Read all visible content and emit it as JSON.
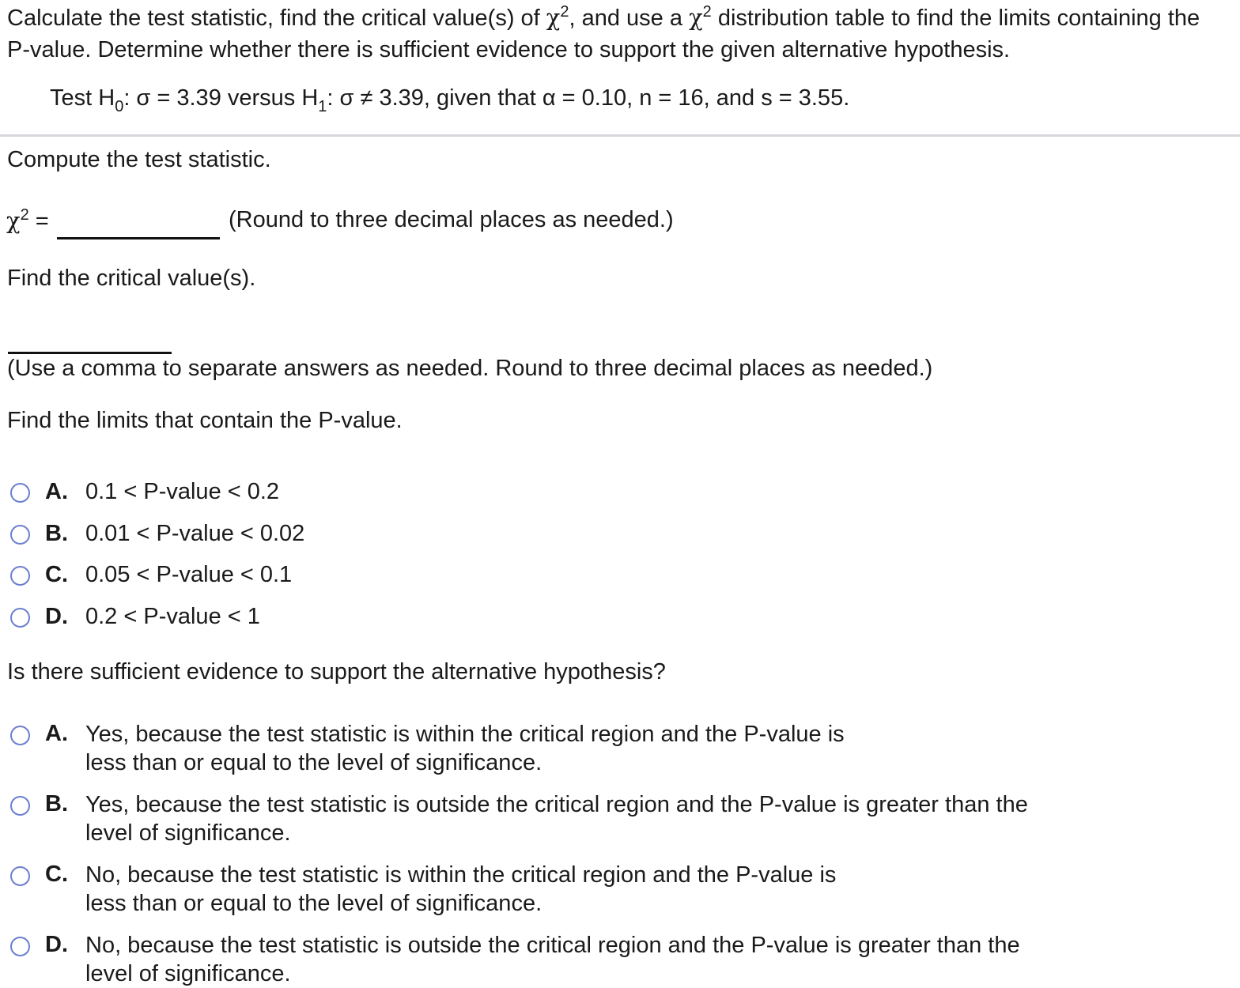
{
  "question": {
    "intro_part1": "Calculate the test statistic, find the critical value(s) of ",
    "chi_symbol": "χ",
    "sup2": "2",
    "intro_part2": ", and use a ",
    "intro_part3": " distribution table to find the limits containing the",
    "intro_line2": "P-value. Determine whether there is sufficient evidence to support the given alternative hypothesis.",
    "test": {
      "prefix": "Test H",
      "h0_sub": "0",
      "h0_rest": ": σ = 3.39 versus H",
      "h1_sub": "1",
      "h1_rest": ": σ ≠ 3.39, given that α = 0.10, n = 16, and s = 3.55."
    }
  },
  "part1": {
    "prompt": "Compute the test statistic.",
    "label_eq": " =",
    "answer_value": "",
    "hint": "(Round to three decimal places as needed.)"
  },
  "part2": {
    "prompt": "Find the critical value(s).",
    "answer_value": "",
    "hint": "(Use a comma to separate answers as needed. Round to three decimal places as needed.)"
  },
  "part3": {
    "prompt": "Find the limits that contain the P-value.",
    "options": [
      {
        "letter": "A.",
        "text": "0.1 < P-value < 0.2"
      },
      {
        "letter": "B.",
        "text": "0.01 < P-value < 0.02"
      },
      {
        "letter": "C.",
        "text": "0.05 < P-value < 0.1"
      },
      {
        "letter": "D.",
        "text": "0.2 < P-value < 1"
      }
    ]
  },
  "part4": {
    "prompt": "Is there sufficient evidence to support the alternative hypothesis?",
    "options": [
      {
        "letter": "A.",
        "line1": "Yes, because the test statistic is within the critical region and the P-value is",
        "line2": "less than or equal to the level of significance."
      },
      {
        "letter": "B.",
        "line1": "Yes, because the test statistic is outside the critical region and the P-value is greater than the",
        "line2": "level of significance."
      },
      {
        "letter": "C.",
        "line1": "No, because the test statistic is within the critical region and the P-value is",
        "line2": "less than or equal to the level of significance."
      },
      {
        "letter": "D.",
        "line1": "No, because the test statistic is outside the critical region and the P-value is greater than the",
        "line2": "level of significance."
      }
    ]
  },
  "colors": {
    "radio_border": "#6c7fd0",
    "divider": "#d6d6dc",
    "text": "#1a1a1a"
  }
}
